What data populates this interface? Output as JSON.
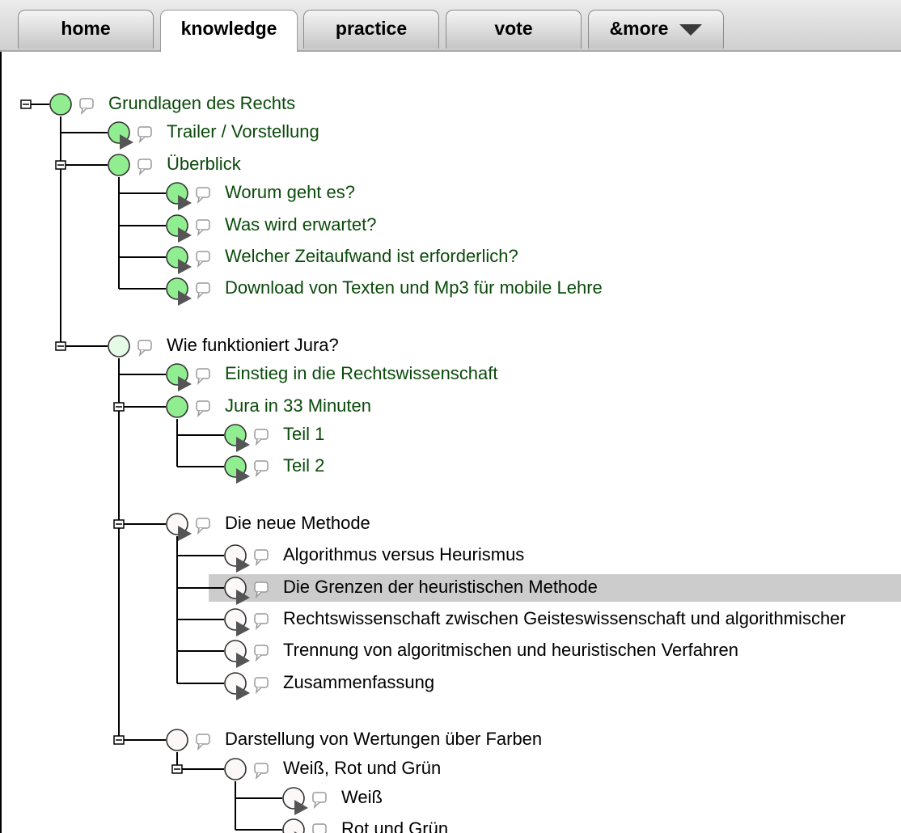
{
  "tabs": [
    {
      "label": "home",
      "active": false
    },
    {
      "label": "knowledge",
      "active": true
    },
    {
      "label": "practice",
      "active": false
    },
    {
      "label": "vote",
      "active": false
    },
    {
      "label": "&more",
      "active": false,
      "dropdown": true
    }
  ],
  "tree": [
    {
      "label": "Grundlagen des Rechts",
      "status": "green",
      "node": "plain",
      "collapsible": true,
      "selected": false
    },
    {
      "label": "Trailer / Vorstellung",
      "status": "green",
      "node": "play",
      "collapsible": false,
      "selected": false
    },
    {
      "label": "Überblick",
      "status": "green",
      "node": "plain",
      "collapsible": true,
      "selected": false
    },
    {
      "label": "Worum geht es?",
      "status": "green",
      "node": "play",
      "collapsible": false,
      "selected": false
    },
    {
      "label": "Was wird erwartet?",
      "status": "green",
      "node": "play",
      "collapsible": false,
      "selected": false
    },
    {
      "label": "Welcher Zeitaufwand ist erforderlich?",
      "status": "green",
      "node": "play",
      "collapsible": false,
      "selected": false
    },
    {
      "label": "Download von Texten und Mp3 für mobile Lehre",
      "status": "green",
      "node": "play",
      "collapsible": false,
      "selected": false
    },
    {
      "label": "Wie funktioniert Jura?",
      "status": "light-green",
      "node": "plain",
      "collapsible": true,
      "selected": false
    },
    {
      "label": "Einstieg in die Rechtswissenschaft",
      "status": "green",
      "node": "play",
      "collapsible": false,
      "selected": false
    },
    {
      "label": "Jura in 33 Minuten",
      "status": "green",
      "node": "plain",
      "collapsible": true,
      "selected": false
    },
    {
      "label": "Teil 1",
      "status": "green",
      "node": "play",
      "collapsible": false,
      "selected": false
    },
    {
      "label": "Teil 2",
      "status": "green",
      "node": "play",
      "collapsible": false,
      "selected": false
    },
    {
      "label": "Die neue Methode",
      "status": "white",
      "node": "play",
      "collapsible": true,
      "selected": false
    },
    {
      "label": "Algorithmus versus Heurismus",
      "status": "white",
      "node": "play",
      "collapsible": false,
      "selected": false
    },
    {
      "label": "Die Grenzen der heuristischen Methode",
      "status": "white",
      "node": "play",
      "collapsible": false,
      "selected": true
    },
    {
      "label": "Rechtswissenschaft zwischen Geisteswissenschaft und algorithmischer",
      "status": "white",
      "node": "play",
      "collapsible": false,
      "selected": false
    },
    {
      "label": "Trennung von algoritmischen und heuristischen Verfahren",
      "status": "white",
      "node": "play",
      "collapsible": false,
      "selected": false
    },
    {
      "label": "Zusammenfassung",
      "status": "white",
      "node": "play",
      "collapsible": false,
      "selected": false
    },
    {
      "label": "Darstellung von Wertungen über Farben",
      "status": "white",
      "node": "plain",
      "collapsible": true,
      "selected": false
    },
    {
      "label": "Weiß, Rot und Grün",
      "status": "white",
      "node": "plain",
      "collapsible": true,
      "selected": false
    },
    {
      "label": "Weiß",
      "status": "white",
      "node": "play",
      "collapsible": false,
      "selected": false
    },
    {
      "label": "Rot und Grün",
      "status": "white",
      "node": "play",
      "collapsible": false,
      "selected": false
    }
  ],
  "colors": {
    "node_green": "#90ee90",
    "node_light_green": "#e6fbe6",
    "node_white": "#fdf8f8",
    "label_green": "#0a4a0a",
    "label_black": "#000000",
    "selection": "#cccccc",
    "play_arrow": "#555555",
    "speech_icon": "#999999"
  },
  "icons": {
    "expander": "collapse-box-icon",
    "node": "status-circle-icon",
    "play": "play-arrow-icon",
    "comment": "speech-bubble-icon",
    "dropdown": "caret-down-icon"
  }
}
